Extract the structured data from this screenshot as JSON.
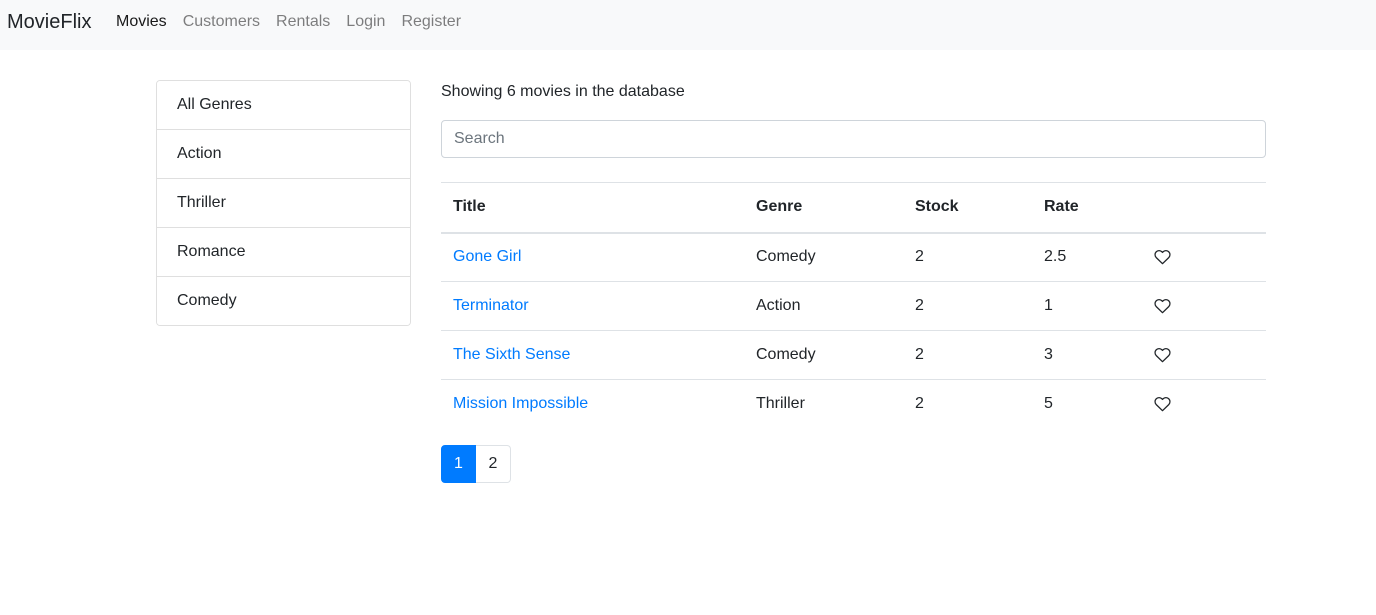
{
  "navbar": {
    "brand": "MovieFlix",
    "links": [
      {
        "label": "Movies",
        "active": true
      },
      {
        "label": "Customers",
        "active": false
      },
      {
        "label": "Rentals",
        "active": false
      },
      {
        "label": "Login",
        "active": false
      },
      {
        "label": "Register",
        "active": false
      }
    ]
  },
  "sidebar": {
    "genres": [
      "All Genres",
      "Action",
      "Thriller",
      "Romance",
      "Comedy"
    ]
  },
  "main": {
    "count_text": "Showing 6 movies in the database",
    "search": {
      "placeholder": "Search",
      "value": ""
    },
    "table": {
      "headers": [
        "Title",
        "Genre",
        "Stock",
        "Rate"
      ],
      "rows": [
        {
          "title": "Gone Girl",
          "genre": "Comedy",
          "stock": "2",
          "rate": "2.5",
          "liked": false
        },
        {
          "title": "Terminator",
          "genre": "Action",
          "stock": "2",
          "rate": "1",
          "liked": false
        },
        {
          "title": "The Sixth Sense",
          "genre": "Comedy",
          "stock": "2",
          "rate": "3",
          "liked": false
        },
        {
          "title": "Mission Impossible",
          "genre": "Thriller",
          "stock": "2",
          "rate": "5",
          "liked": false
        }
      ],
      "like_icon": "heart-outline-icon"
    },
    "pagination": {
      "pages": [
        "1",
        "2"
      ],
      "current": "1"
    }
  },
  "colors": {
    "accent": "#007bff",
    "navbar_bg": "#f8f9fa"
  }
}
